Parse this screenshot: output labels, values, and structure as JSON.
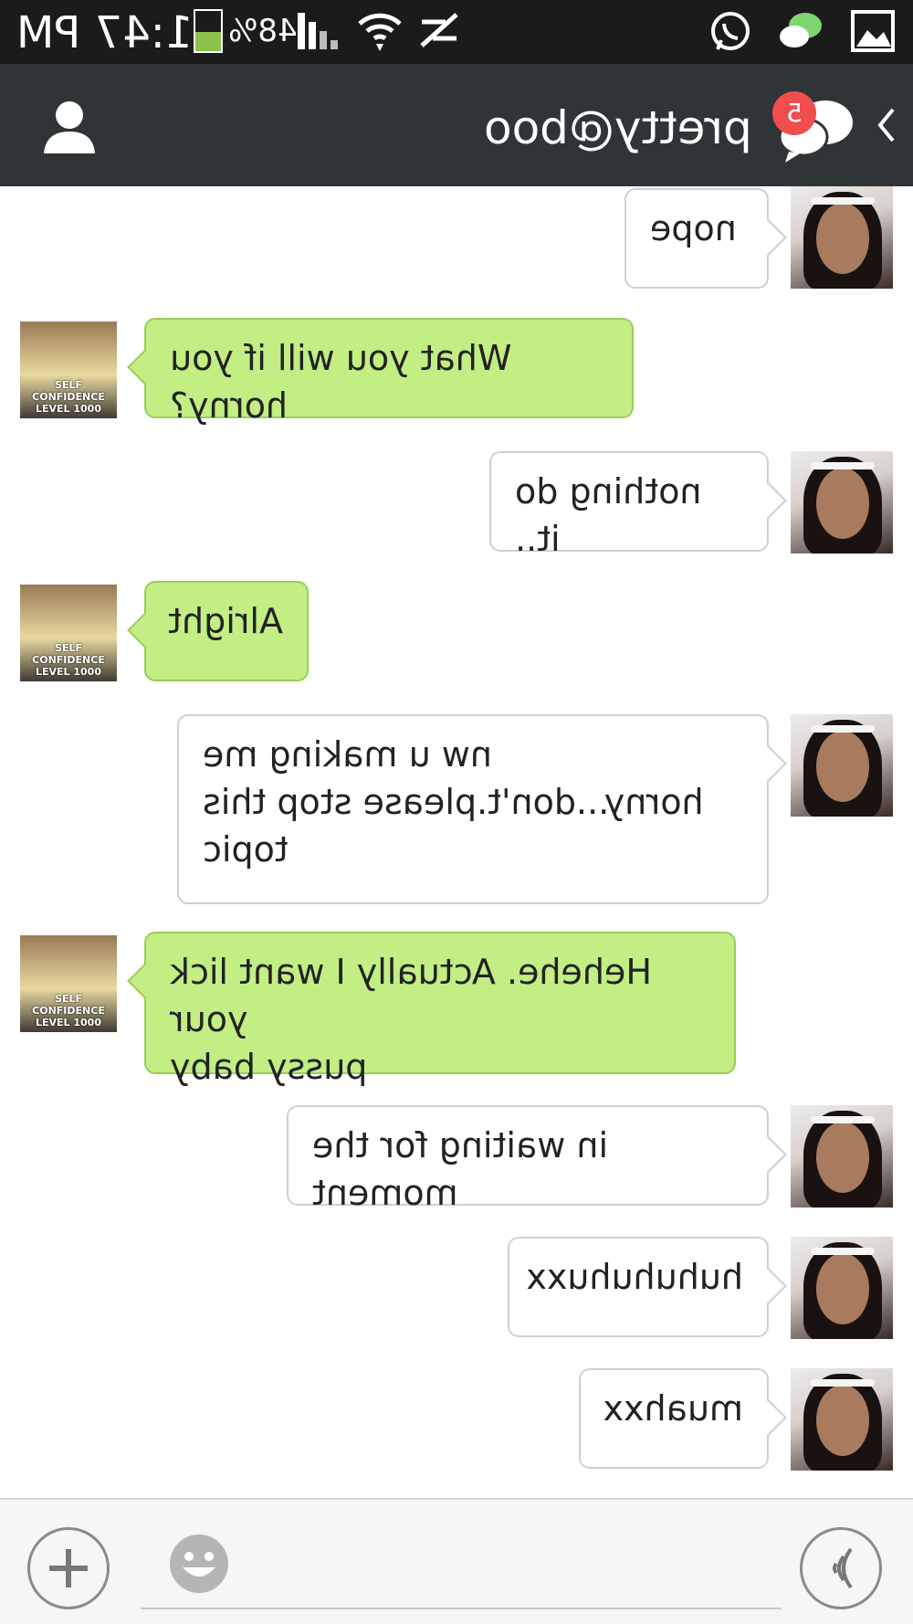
{
  "status_bar": {
    "time": "1:47 PM",
    "battery_percent": "48%",
    "battery_level": 0.48
  },
  "header": {
    "title": "pretty@boo",
    "unread_badge": "5"
  },
  "messages": [
    {
      "sender": "her",
      "text": "nope"
    },
    {
      "sender": "me",
      "text": "What you will if you horny?"
    },
    {
      "sender": "her",
      "text": "nothing do it.."
    },
    {
      "sender": "me",
      "text": "Alright"
    },
    {
      "sender": "her",
      "text": "nw u making me\nhorny...don't.please stop this\ntopic"
    },
    {
      "sender": "me",
      "text": "Hehehe. Actually I want lick your\npussy baby"
    },
    {
      "sender": "her",
      "text": "in waiting for the moment"
    },
    {
      "sender": "her",
      "text": "huhuhuhuxx"
    },
    {
      "sender": "her",
      "text": "muahxx"
    }
  ],
  "avatar_caption": "SELF CONFIDENCE LEVEL 1000",
  "colors": {
    "header_bg": "#2f3437",
    "my_bubble": "#c2ee84",
    "her_bubble": "#ffffff",
    "badge": "#f04d4d"
  },
  "icons": {
    "profile": "person-icon",
    "chats": "chat-bubbles-icon",
    "back": "chevron-left-icon",
    "plus": "plus-icon",
    "emoji": "smiley-icon",
    "voice": "voice-wave-icon"
  }
}
